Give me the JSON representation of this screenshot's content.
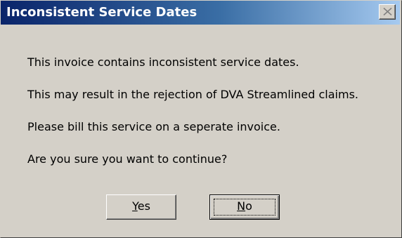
{
  "window": {
    "title": "Inconsistent Service Dates",
    "close_icon": "close-icon"
  },
  "messages": [
    "This invoice contains inconsistent service dates.",
    "This may result in the rejection of DVA Streamlined claims.",
    "Please bill this service on a seperate invoice.",
    "Are you sure you want to continue?"
  ],
  "buttons": {
    "yes": {
      "accel": "Y",
      "rest": "es"
    },
    "no": {
      "accel": "N",
      "rest": "o",
      "default": true
    }
  },
  "colors": {
    "titlebar_start": "#0a246a",
    "titlebar_end": "#a6caf0",
    "face": "#d4d0c8"
  }
}
